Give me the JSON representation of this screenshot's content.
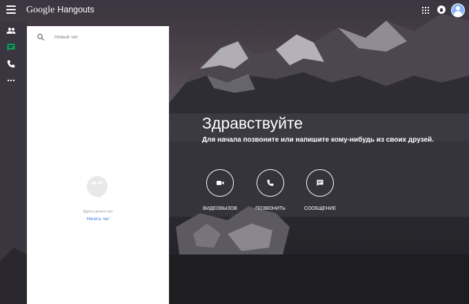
{
  "app": {
    "brand_google": "Google",
    "brand_product": "Hangouts"
  },
  "header": {
    "icons": [
      "menu-icon",
      "apps-grid-icon",
      "notifications-icon",
      "avatar"
    ]
  },
  "rail": {
    "items": [
      {
        "name": "contacts",
        "icon": "people-icon"
      },
      {
        "name": "conversations",
        "icon": "chat-icon",
        "active": true
      },
      {
        "name": "calls",
        "icon": "phone-icon"
      },
      {
        "name": "more",
        "icon": "more-horizontal-icon"
      }
    ]
  },
  "panel": {
    "search_placeholder": "Новый чат",
    "empty_text": "Здесь ничего нет",
    "start_chat": "Начать чат",
    "empty_icon_glyph": "“”"
  },
  "welcome": {
    "title": "Здравствуйте",
    "subtitle": "Для начала позвоните или напишите кому-нибудь из своих друзей."
  },
  "actions": [
    {
      "label": "ВИДЕОВЫЗОВ",
      "icon": "video-icon"
    },
    {
      "label": "ПОЗВОНИТЬ",
      "icon": "phone-icon"
    },
    {
      "label": "СООБЩЕНИЕ",
      "icon": "message-icon"
    }
  ],
  "colors": {
    "accent_active": "#0f9d58",
    "link": "#3c78d8",
    "panel_bg": "#ffffff"
  }
}
